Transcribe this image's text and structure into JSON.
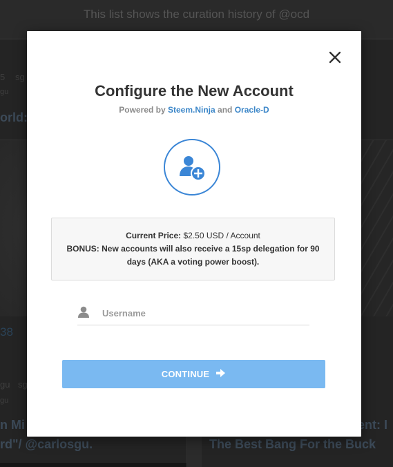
{
  "background": {
    "banner_text": "This list shows the curation history of @ocd",
    "left_meta": "5",
    "left_meta2": "sg",
    "left_sub": "gu",
    "left_title_1": "orld:",
    "left_number": "38",
    "left_meta3": "gu",
    "left_meta4": "sg",
    "left_sub2": "gu",
    "left_title_2": "n Mi",
    "left_title_3": "rd\"/ @carlosgu.",
    "right_title_1": "ement: I",
    "right_title_2": "The Best Bang For the Buck"
  },
  "modal": {
    "title": "Configure the New Account",
    "powered_prefix": "Powered by",
    "powered_link1": "Steem.Ninja",
    "powered_and": "and",
    "powered_link2": "Oracle-D",
    "price_label": "Current Price:",
    "price_value": "$2.50 USD / Account",
    "bonus_text": "BONUS: New accounts will also receive a 15sp delegation for 90 days (AKA a voting power boost).",
    "username_placeholder": "Username",
    "username_value": "",
    "continue_label": "CONTINUE"
  },
  "icons": {
    "close": "close-icon",
    "add_user": "add-user-icon",
    "user": "user-icon",
    "arrow": "arrow-right-icon"
  },
  "colors": {
    "accent": "#3b86d6",
    "link": "#3b86c8",
    "button": "#7ab9f1"
  }
}
